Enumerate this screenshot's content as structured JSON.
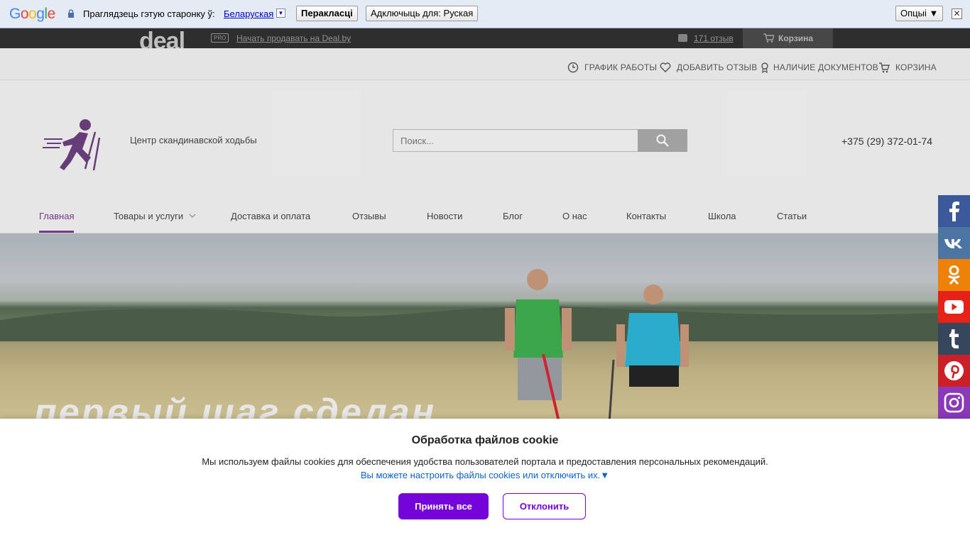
{
  "translate_bar": {
    "prompt": "Праглядзець гэтую старонку ў:",
    "language": "Беларуская",
    "translate_button": "Перакласці",
    "disable_button": "Адключыць для: Руская",
    "options_button": "Опцыі ▼",
    "close_glyph": "✕",
    "dropdown_glyph": "▼"
  },
  "deal_bar": {
    "logo": "deal",
    "pro_badge": "PRO",
    "sell_link": "Начать продавать на Deal.by",
    "reviews_link": "171 отзыв",
    "cart_label": "Корзина"
  },
  "utility": {
    "schedule": "ГРАФИК РАБОТЫ",
    "add_review": "ДОБАВИТЬ ОТЗЫВ",
    "documents": "НАЛИЧИЕ ДОКУМЕНТОВ",
    "cart": "КОРЗИНА"
  },
  "header": {
    "tagline": "Центр скандинавской ходьбы",
    "search_placeholder": "Поиск...",
    "phone": "+375 (29) 372-01-74"
  },
  "nav": {
    "items": [
      {
        "label": "Главная",
        "active": true
      },
      {
        "label": "Товары и услуги"
      },
      {
        "label": "Доставка и оплата"
      },
      {
        "label": "Отзывы"
      },
      {
        "label": "Новости"
      },
      {
        "label": "Блог"
      },
      {
        "label": "О нас"
      },
      {
        "label": "Контакты"
      },
      {
        "label": "Школа"
      },
      {
        "label": "Статьи"
      }
    ]
  },
  "hero": {
    "headline": "первый шаг сделан"
  },
  "social": [
    {
      "name": "facebook-icon",
      "color": "#3b5998"
    },
    {
      "name": "vk-icon",
      "color": "#4c75a3"
    },
    {
      "name": "odnoklassniki-icon",
      "color": "#ee8208"
    },
    {
      "name": "youtube-icon",
      "color": "#e62117"
    },
    {
      "name": "tumblr-icon",
      "color": "#36465d"
    },
    {
      "name": "pinterest-icon",
      "color": "#cb2027"
    },
    {
      "name": "instagram-icon",
      "color": "#8a3ab9"
    }
  ],
  "cookie": {
    "title": "Обработка файлов cookie",
    "text": "Мы используем файлы cookies для обеспечения удобства пользователей портала и предоставления персональных рекомендаций.",
    "link": "Вы можете настроить файлы cookies или отключить их.▼",
    "accept": "Принять все",
    "decline": "Отклонить"
  },
  "colors": {
    "brand_purple": "#7a3a8f",
    "cookie_accent": "#7404d9",
    "link_blue": "#0a63c9"
  }
}
